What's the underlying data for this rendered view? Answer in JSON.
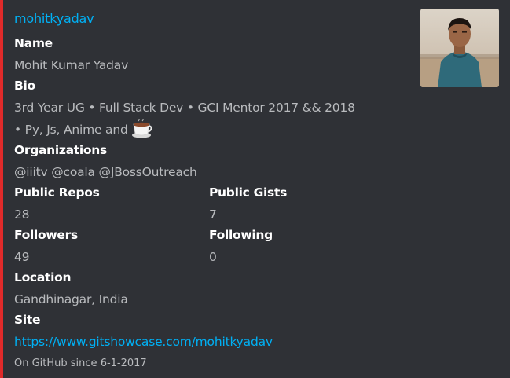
{
  "author": "mohitkyadav",
  "fields": {
    "name": {
      "label": "Name",
      "value": "Mohit Kumar Yadav"
    },
    "bio": {
      "label": "Bio",
      "line1": "3rd Year UG • Full Stack Dev • GCI Mentor 2017 && 2018",
      "line2": "• Py, Js, Anime and"
    },
    "organizations": {
      "label": "Organizations",
      "value": "@iiitv @coala @JBossOutreach"
    },
    "public_repos": {
      "label": "Public Repos",
      "value": "28"
    },
    "public_gists": {
      "label": "Public Gists",
      "value": "7"
    },
    "followers": {
      "label": "Followers",
      "value": "49"
    },
    "following": {
      "label": "Following",
      "value": "0"
    },
    "location": {
      "label": "Location",
      "value": "Gandhinagar, India"
    },
    "site": {
      "label": "Site",
      "value": "https://www.gitshowcase.com/mohitkyadav"
    }
  },
  "footer": "On GitHub since 6-1-2017",
  "icons": {
    "bio_emoji": "coffee-cup-icon",
    "thumbnail": "avatar-photo"
  },
  "colors": {
    "accent_bar": "#e02a2a",
    "link": "#00b0f4",
    "background": "#2f3136"
  }
}
